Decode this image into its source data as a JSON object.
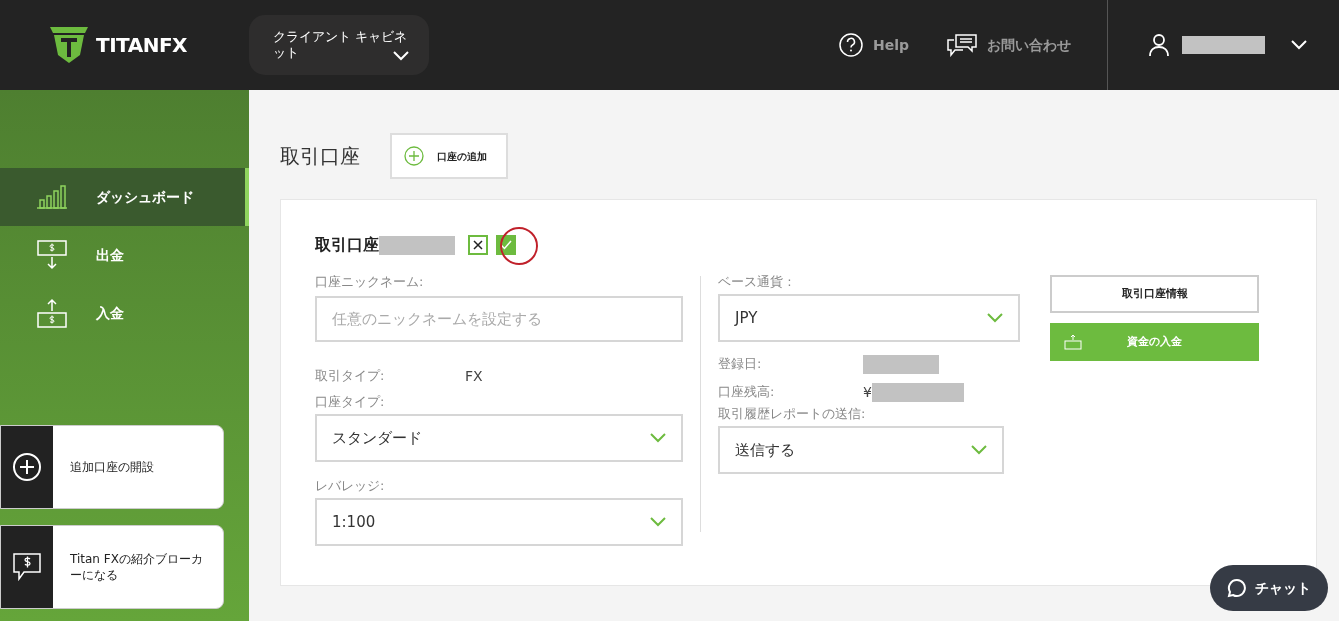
{
  "header": {
    "logo": "TITANFX",
    "cabinet_menu": "クライアント キャビネット",
    "help": "Help",
    "contact": "お問い合わせ"
  },
  "sidebar": {
    "items": [
      {
        "label": "ダッシュボード",
        "selected": true
      },
      {
        "label": "出金",
        "selected": false
      },
      {
        "label": "入金",
        "selected": false
      }
    ],
    "cards": [
      {
        "label": "追加口座の開設"
      },
      {
        "label": "Titan FXの紹介ブローカーになる"
      }
    ]
  },
  "page": {
    "title": "取引口座",
    "add_button": "口座の追加"
  },
  "account": {
    "title": "取引口座",
    "left_fields": [
      {
        "kind": "input",
        "label": "口座ニックネーム:",
        "placeholder": "任意のニックネームを設定する"
      },
      {
        "kind": "text",
        "label": "取引タイプ:",
        "value": "FX"
      },
      {
        "kind": "select",
        "label": "口座タイプ:",
        "value": "スタンダード"
      },
      {
        "kind": "select",
        "label": "レバレッジ:",
        "value": "1:100"
      }
    ],
    "right_fields": [
      {
        "kind": "select",
        "label": "ベース通貨 :",
        "value": "JPY"
      },
      {
        "kind": "hidden",
        "label": "登録日:"
      },
      {
        "kind": "hidden",
        "label": "口座残高:",
        "prefix": "¥"
      },
      {
        "kind": "select",
        "label": "取引履歴レポートの送信:",
        "value": "送信する"
      }
    ],
    "buttons": [
      {
        "kind": "outline",
        "label": "取引口座情報"
      },
      {
        "kind": "primary",
        "label": "資金の入金"
      }
    ]
  },
  "chat_button": "チャット"
}
